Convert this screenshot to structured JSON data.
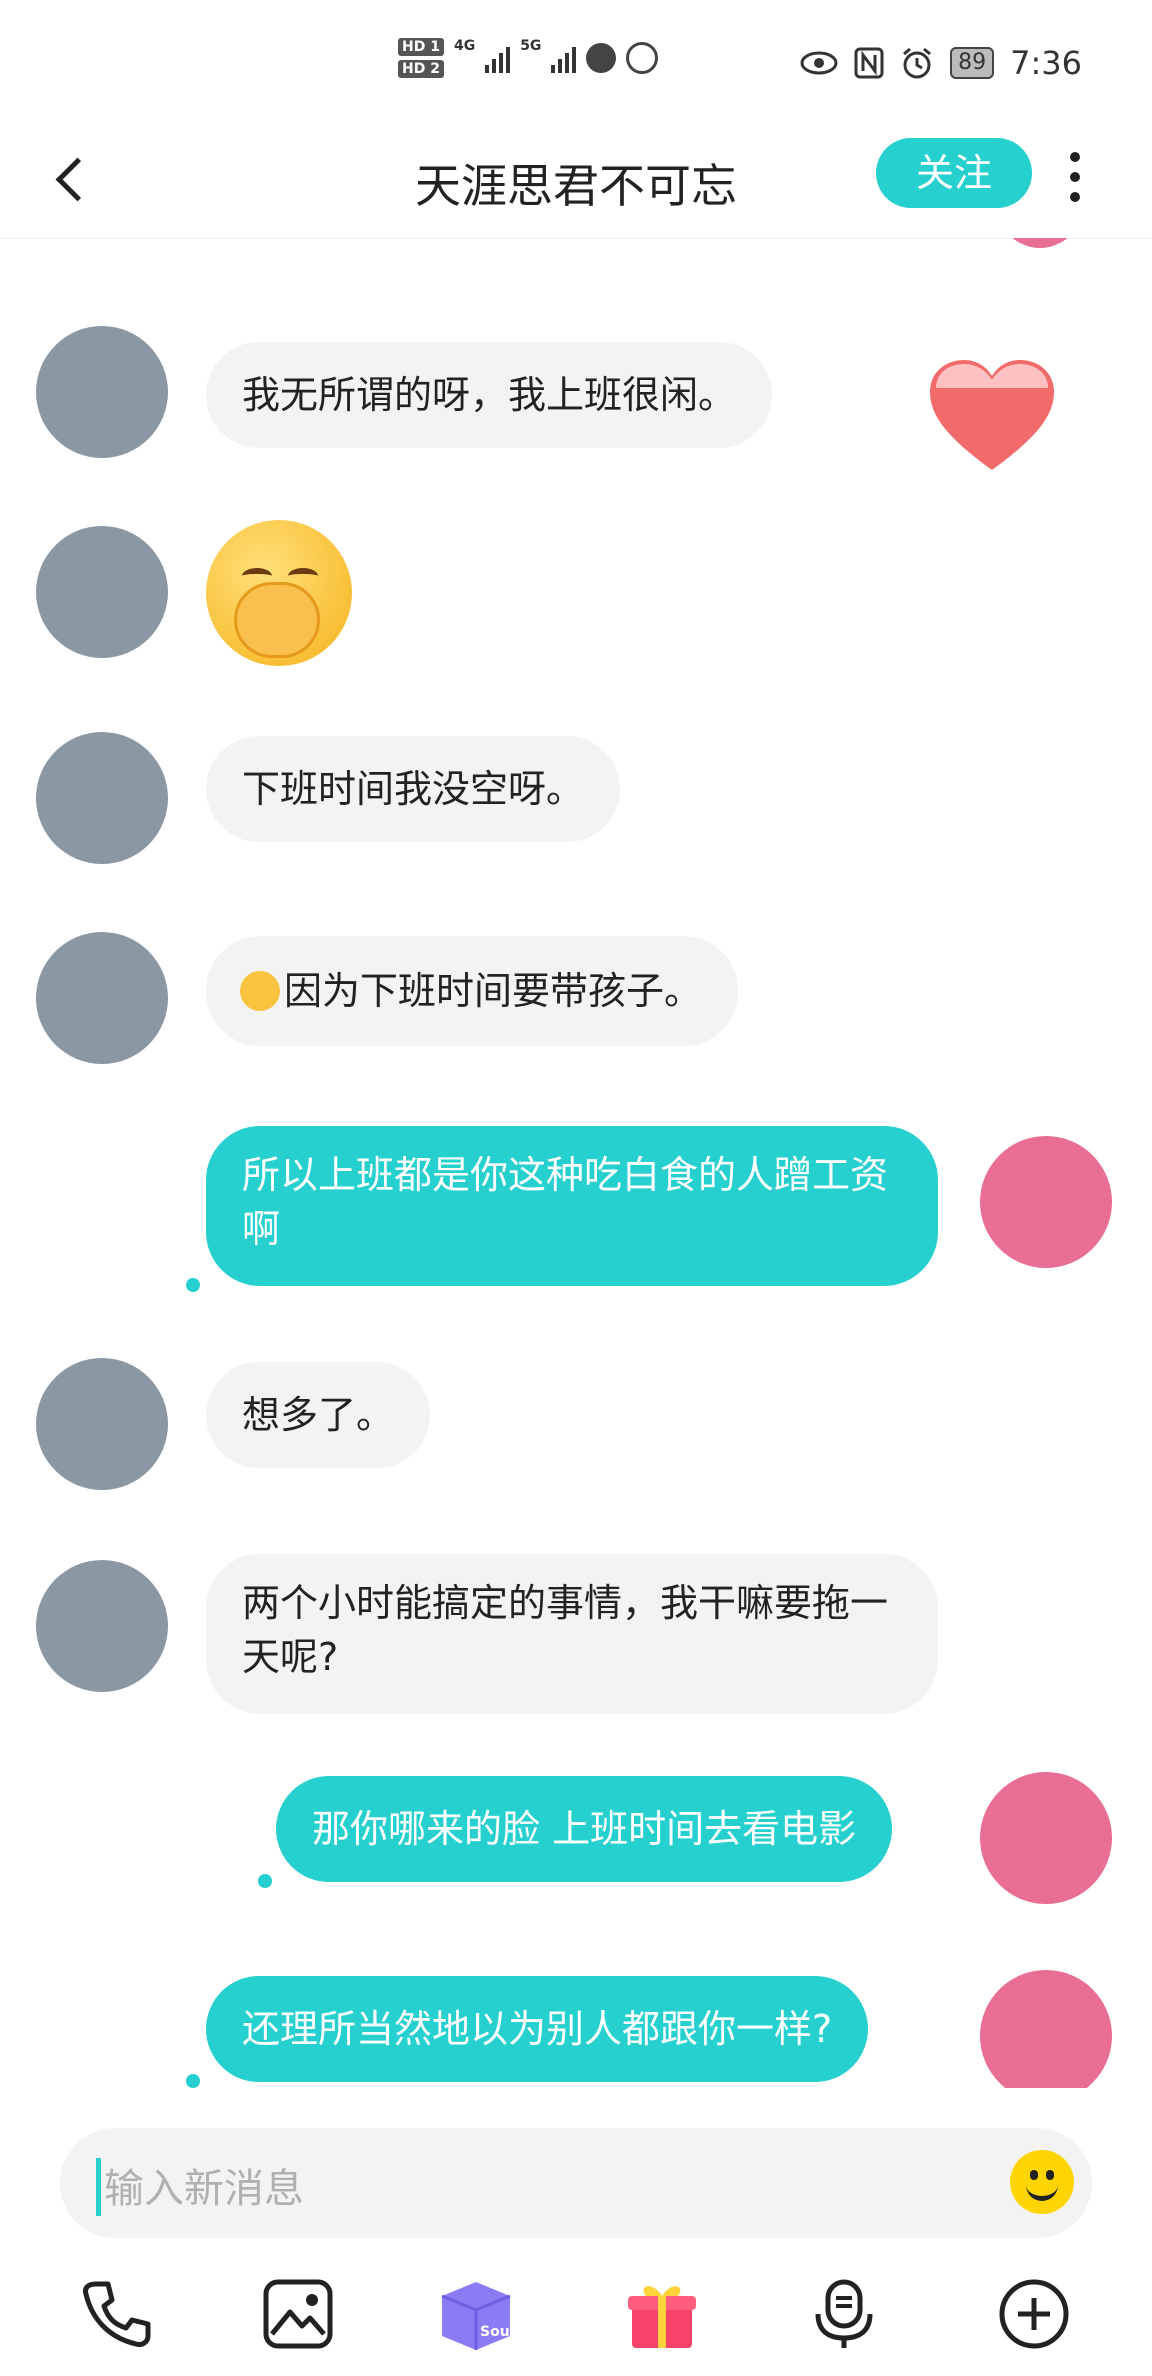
{
  "status_bar": {
    "sim1": "HD 1",
    "sim2": "HD 2",
    "net1": "4G",
    "net2": "5G",
    "battery": "89",
    "time": "7:36"
  },
  "header": {
    "title": "天涯思君不可忘",
    "follow_label": "关注"
  },
  "messages": [
    {
      "from": "other",
      "text": "我无所谓的呀，我上班很闲。"
    },
    {
      "from": "other",
      "type": "emoji",
      "emoji": "face-with-hand-over-mouth"
    },
    {
      "from": "other",
      "text": "下班时间我没空呀。"
    },
    {
      "from": "other",
      "text": "因为下班时间要带孩子。",
      "leading_emoji": "loudly-crying-face"
    },
    {
      "from": "me",
      "text": "所以上班都是你这种吃白食的人蹭工资啊"
    },
    {
      "from": "other",
      "text": "想多了。"
    },
    {
      "from": "other",
      "text": "两个小时能搞定的事情，我干嘛要拖一天呢?"
    },
    {
      "from": "me",
      "text": "那你哪来的脸 上班时间去看电影"
    },
    {
      "from": "me",
      "text": "还理所当然地以为别人都跟你一样?"
    }
  ],
  "input": {
    "placeholder": "输入新消息"
  },
  "toolbar": {
    "items": [
      "phone-icon",
      "image-icon",
      "soul-box-icon",
      "gift-icon",
      "voice-icon",
      "add-icon"
    ],
    "soul_label": "Soul"
  },
  "colors": {
    "accent": "#25d0cf",
    "incoming_bubble": "#f3f3f3",
    "outgoing_text": "#ffffff"
  }
}
